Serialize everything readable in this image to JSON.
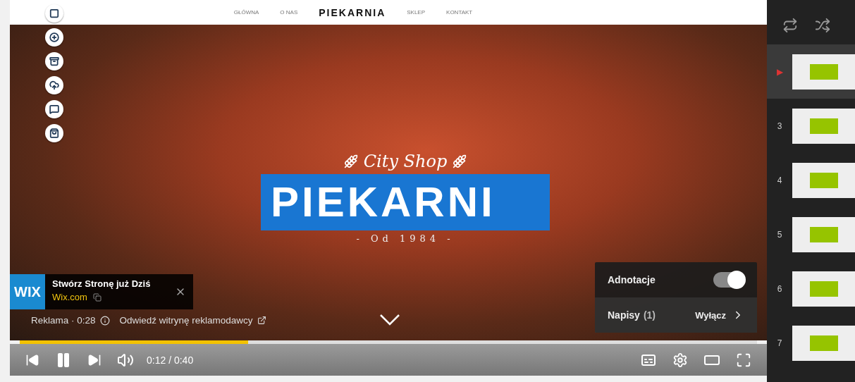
{
  "site_nav": [
    {
      "label": "GŁÓWNA",
      "kind": "link"
    },
    {
      "label": "O NAS",
      "kind": "link"
    },
    {
      "label": "PIEKARNIA",
      "kind": "logo"
    },
    {
      "label": "SKLEP",
      "kind": "link"
    },
    {
      "label": "KONTAKT",
      "kind": "link"
    }
  ],
  "hero": {
    "tagline": "City Shop",
    "title": "PIEKARNI",
    "since": "- Od 1984 -"
  },
  "ad": {
    "logo": "WIX",
    "title": "Stwórz Stronę już Dziś",
    "domain": "Wix.com",
    "label": "Reklama · 0:28",
    "visit": "Odwiedź witrynę reklamodawcy"
  },
  "settings_menu": {
    "annotations": {
      "label": "Adnotacje",
      "on": true
    },
    "captions": {
      "label": "Napisy",
      "count": "(1)",
      "value": "Wyłącz"
    }
  },
  "player": {
    "level": 0.31,
    "time": "0:12 / 0:40"
  },
  "playlist": [
    {
      "index": "▶",
      "selected": true
    },
    {
      "index": "3",
      "selected": false
    },
    {
      "index": "4",
      "selected": false
    },
    {
      "index": "5",
      "selected": false
    },
    {
      "index": "6",
      "selected": false
    },
    {
      "index": "7",
      "selected": false
    }
  ]
}
